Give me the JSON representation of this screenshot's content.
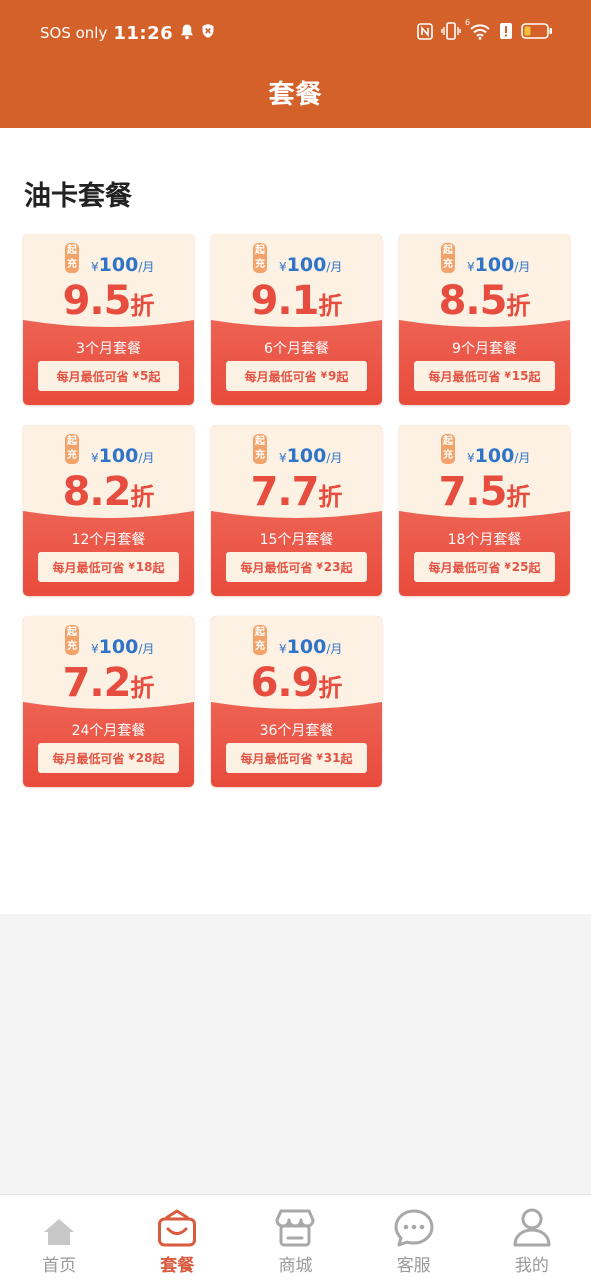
{
  "status_bar": {
    "carrier": "SOS only",
    "time": "11:26",
    "network_badge": "6",
    "icons": [
      "bell-icon",
      "vpn-shield-icon",
      "nfc-icon",
      "vibrate-icon",
      "wifi-icon",
      "alert-icon",
      "battery-icon"
    ]
  },
  "header": {
    "title": "套餐"
  },
  "section": {
    "title": "油卡套餐"
  },
  "card_common": {
    "badge_top": "起",
    "badge_bottom": "充",
    "currency": "¥",
    "amount": "100",
    "unit": "/月",
    "discount_suffix": "折",
    "save_prefix": "每月最低可省",
    "save_currency": "¥",
    "save_suffix": "起"
  },
  "plans": [
    {
      "rate": "9.5",
      "label": "3个月套餐",
      "save": "5"
    },
    {
      "rate": "9.1",
      "label": "6个月套餐",
      "save": "9"
    },
    {
      "rate": "8.5",
      "label": "9个月套餐",
      "save": "15"
    },
    {
      "rate": "8.2",
      "label": "12个月套餐",
      "save": "18"
    },
    {
      "rate": "7.7",
      "label": "15个月套餐",
      "save": "23"
    },
    {
      "rate": "7.5",
      "label": "18个月套餐",
      "save": "25"
    },
    {
      "rate": "7.2",
      "label": "24个月套餐",
      "save": "28"
    },
    {
      "rate": "6.9",
      "label": "36个月套餐",
      "save": "31"
    }
  ],
  "nav": {
    "items": [
      {
        "label": "首页",
        "icon": "home-icon",
        "active": false
      },
      {
        "label": "套餐",
        "icon": "package-bag-icon",
        "active": true
      },
      {
        "label": "商城",
        "icon": "store-icon",
        "active": false
      },
      {
        "label": "客服",
        "icon": "chat-bubble-icon",
        "active": false
      },
      {
        "label": "我的",
        "icon": "user-icon",
        "active": false
      }
    ]
  },
  "colors": {
    "header_bg": "#d4612a",
    "card_top": "#fdf1e3",
    "card_bottom": "#e84b3c",
    "discount_text": "#e74d3e",
    "price_text": "#2f74c6",
    "nav_active": "#d95a3e",
    "nav_inactive": "#a8a8a8"
  }
}
